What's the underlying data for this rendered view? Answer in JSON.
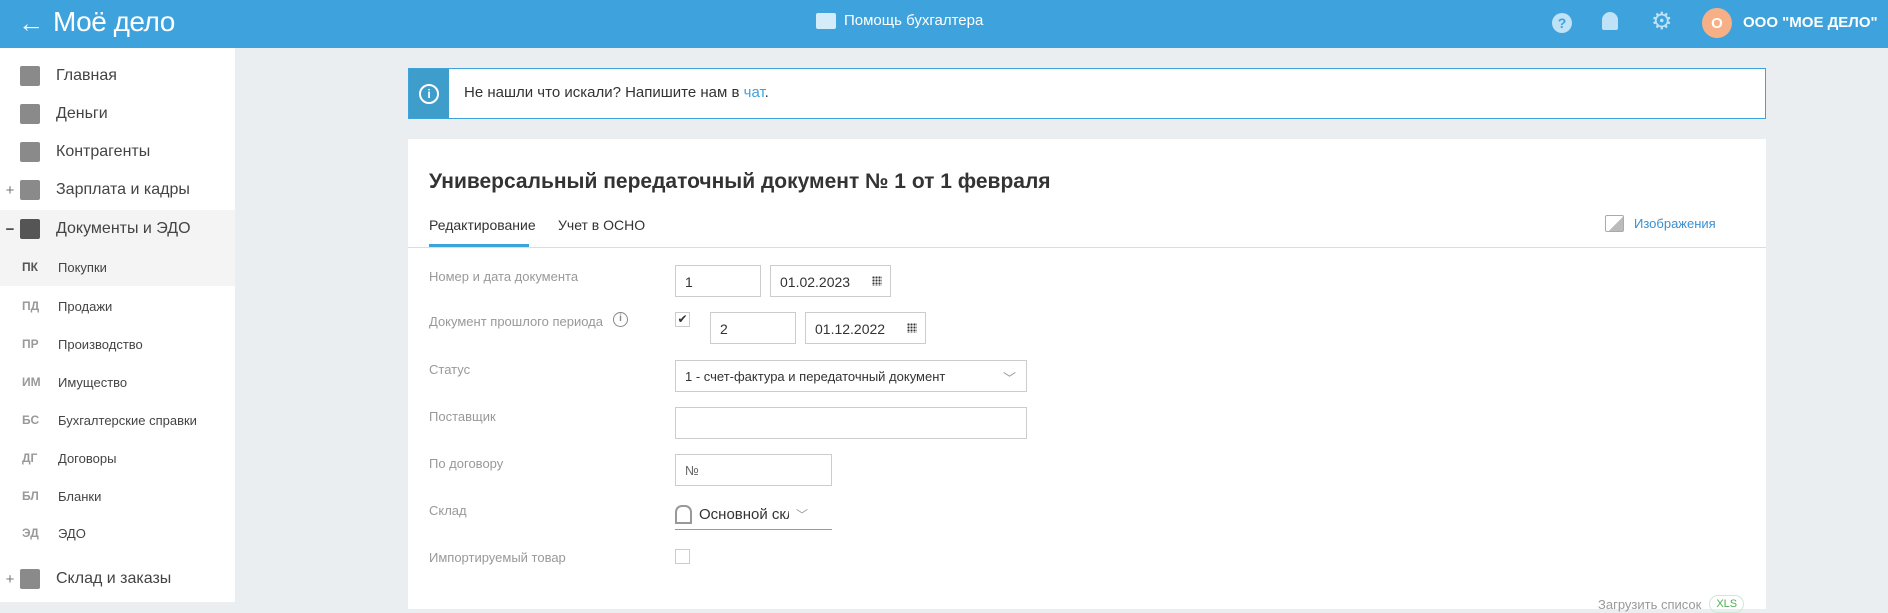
{
  "header": {
    "back": "←",
    "logo": "Моё дело",
    "help": "Помощь бухгалтера",
    "avatar": "О",
    "org": "ООО \"МОЕ ДЕЛО\""
  },
  "sidebar": {
    "items": [
      {
        "label": "Главная",
        "pm": ""
      },
      {
        "label": "Деньги",
        "pm": ""
      },
      {
        "label": "Контрагенты",
        "pm": ""
      },
      {
        "label": "Зарплата и кадры",
        "pm": "+"
      },
      {
        "label": "Документы и ЭДО",
        "pm": "−"
      }
    ],
    "sub": [
      {
        "ab": "ПК",
        "label": "Покупки"
      },
      {
        "ab": "ПД",
        "label": "Продажи"
      },
      {
        "ab": "ПР",
        "label": "Производство"
      },
      {
        "ab": "ИМ",
        "label": "Имущество"
      },
      {
        "ab": "БС",
        "label": "Бухгалтерские справки"
      },
      {
        "ab": "ДГ",
        "label": "Договоры"
      },
      {
        "ab": "БЛ",
        "label": "Бланки"
      },
      {
        "ab": "ЭД",
        "label": "ЭДО"
      }
    ],
    "last": {
      "label": "Склад и заказы",
      "pm": "+"
    }
  },
  "banner": {
    "text": "Не нашли что искали? Напишите нам в ",
    "link": "чат",
    "end": "."
  },
  "doc": {
    "title": "Универсальный передаточный документ № 1 от 1 февраля",
    "tabs": [
      "Редактирование",
      "Учет в ОСНО"
    ],
    "images": "Изображения",
    "fields": {
      "num_label": "Номер и дата документа",
      "num": "1",
      "date": "01.02.2023",
      "prev_label": "Документ прошлого периода",
      "prev_checked": "✔",
      "prev_num": "2",
      "prev_date": "01.12.2022",
      "status_label": "Статус",
      "status": "1 - счет-фактура и передаточный документ",
      "supplier_label": "Поставщик",
      "supplier": "",
      "contract_label": "По договору",
      "contract_placeholder": "№",
      "warehouse_label": "Склад",
      "warehouse": "Основной скл",
      "import_label": "Импортируемый товар"
    },
    "footer": {
      "load": "Загрузить список",
      "xls": "XLS"
    }
  }
}
